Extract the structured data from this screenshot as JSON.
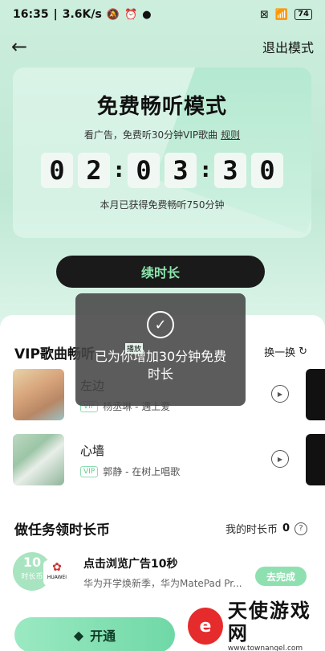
{
  "status_bar": {
    "time": "16:35",
    "speed": "3.6K/s",
    "battery": "74"
  },
  "nav": {
    "back_icon": "back-arrow-icon",
    "exit_label": "退出模式"
  },
  "card": {
    "title": "免费畅听模式",
    "subtitle": "看广告，免费听30分钟VIP歌曲",
    "rule_link": "规则",
    "timer_digits": [
      "0",
      "2",
      "0",
      "3",
      "3",
      "0"
    ],
    "footer": "本月已获得免费畅听750分钟"
  },
  "extend_button": "续时长",
  "vip_section": {
    "title": "VIP歌曲畅听",
    "swap_label": "换一换",
    "songs": [
      {
        "title": "左边",
        "tag": "VIP",
        "meta": "杨丞琳 - 遇上爱"
      },
      {
        "title": "心墙",
        "tag": "VIP",
        "meta": "郭静 - 在树上唱歌"
      }
    ]
  },
  "tasks_section": {
    "title": "做任务领时长币",
    "coins_label": "我的时长币",
    "coins_value": "0",
    "task": {
      "badge_number": "10",
      "badge_unit": "时长币",
      "brand": "HUAWEI",
      "title": "点击浏览广告10秒",
      "desc": "华为开学焕新季，华为MatePad Pr...",
      "action": "去完成"
    }
  },
  "open_button": "开通",
  "toast": {
    "text": "已为你增加30分钟免费时长",
    "play_label": "播放"
  },
  "watermark": {
    "name": "天使游戏网",
    "url": "www.townangel.com"
  },
  "colors": {
    "accent_green": "#8ce6ad",
    "dark_button": "#1a1a1a"
  }
}
